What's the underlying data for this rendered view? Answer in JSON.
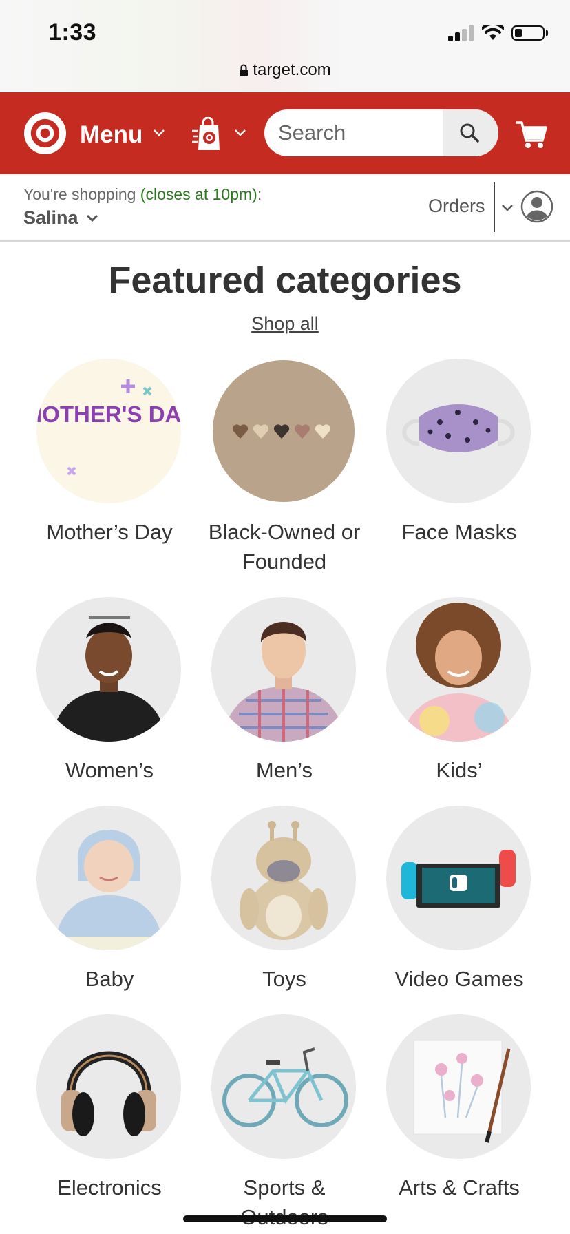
{
  "status": {
    "time": "1:33",
    "url": "target.com"
  },
  "header": {
    "menu_label": "Menu",
    "search_placeholder": "Search"
  },
  "store": {
    "shopping_prefix": "You're shopping",
    "closes": "(closes at 10pm)",
    "suffix": ":",
    "store_name": "Salina",
    "orders_label": "Orders"
  },
  "featured": {
    "title": "Featured categories",
    "shop_all": "Shop all",
    "mothers_day_art_text": "MOTHER'S DAY",
    "categories": [
      {
        "label": "Mother’s Day",
        "icon": "mothers-day-image"
      },
      {
        "label": "Black-Owned or Founded",
        "icon": "hearts-image"
      },
      {
        "label": "Face Masks",
        "icon": "face-mask-image"
      },
      {
        "label": "Women’s",
        "icon": "women-model-image"
      },
      {
        "label": "Men’s",
        "icon": "men-model-image"
      },
      {
        "label": "Kids’",
        "icon": "kid-model-image"
      },
      {
        "label": "Baby",
        "icon": "baby-image"
      },
      {
        "label": "Toys",
        "icon": "giraffe-toy-image"
      },
      {
        "label": "Video Games",
        "icon": "nintendo-switch-image"
      },
      {
        "label": "Electronics",
        "icon": "headphones-image"
      },
      {
        "label": "Sports & Outdoors",
        "icon": "bicycle-image"
      },
      {
        "label": "Arts & Crafts",
        "icon": "painting-image"
      }
    ]
  },
  "colors": {
    "brand_red": "#c62b21",
    "closes_green": "#2b7a1f"
  }
}
